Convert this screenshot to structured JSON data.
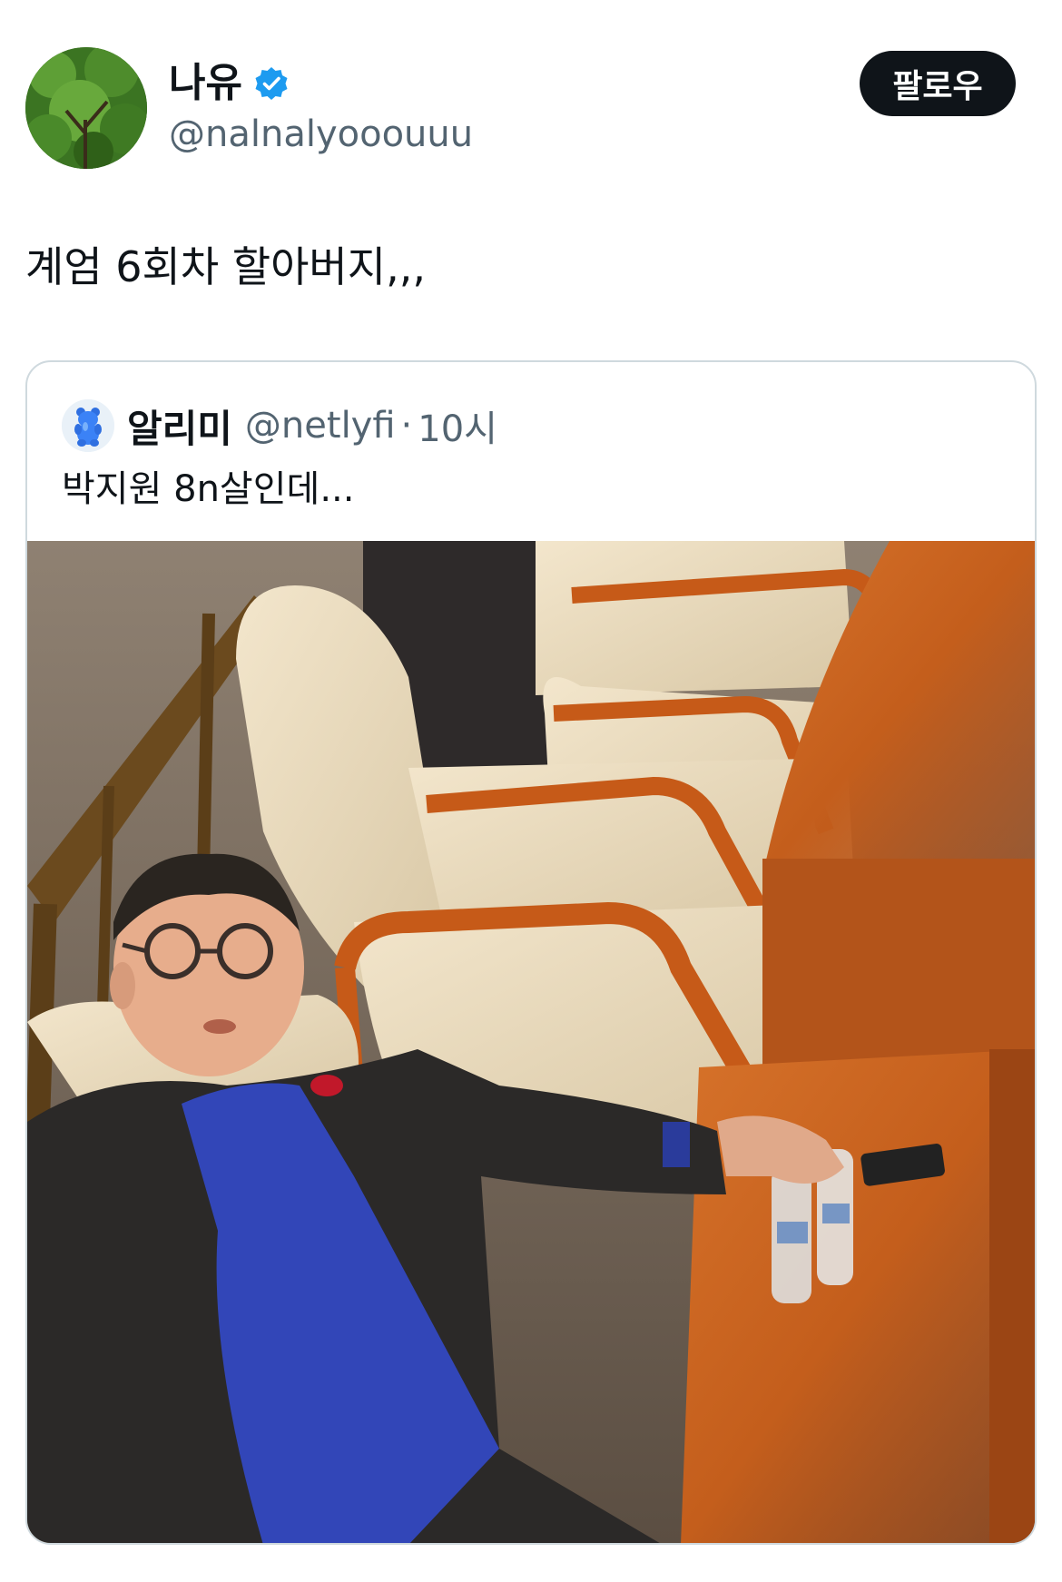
{
  "author": {
    "display_name": "나유",
    "handle": "@nalnalyooouuu",
    "avatar_icon": "tree-avatar",
    "verified_color": "#1d9bf0"
  },
  "follow_button": {
    "label": "팔로우"
  },
  "tweet": {
    "text": "계엄 6회차 할아버지,,,"
  },
  "quoted_tweet": {
    "author_name": "알리미",
    "handle": "@netlyfi",
    "separator": "·",
    "time": "10시",
    "avatar_icon": "gummy-bear-icon",
    "text": "박지원 8n살인데...",
    "media_description_icon": "photo-sleeping-man-in-assembly"
  },
  "colors": {
    "text_primary": "#0f1419",
    "text_secondary": "#536471",
    "button_bg": "#0f1419",
    "border": "#cfd9de"
  }
}
